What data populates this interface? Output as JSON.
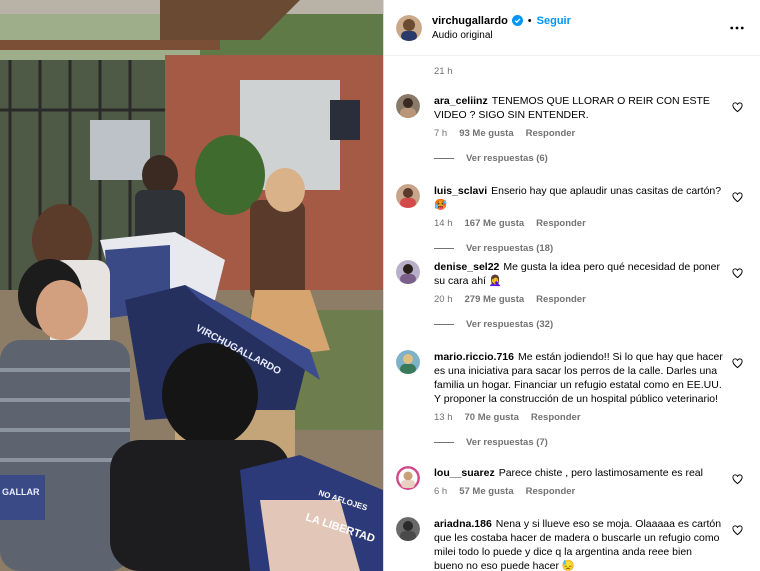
{
  "header": {
    "username": "virchugallardo",
    "follow_label": "Seguir",
    "separator": "•",
    "audio": "Audio original",
    "more_icon": "more-options-icon"
  },
  "top_time": "21 h",
  "comments": [
    {
      "user": "ara_celiinz",
      "text": "TENEMOS QUE LLORAR O REIR CON ESTE VIDEO ? SIGO SIN ENTENDER.",
      "time": "7 h",
      "likes": "93 Me gusta",
      "reply": "Responder",
      "replies": "Ver respuestas (6)"
    },
    {
      "user": "luis_sclavi",
      "text": "Enserio hay que aplaudir unas casitas de cartón? 🥵",
      "time": "14 h",
      "likes": "167 Me gusta",
      "reply": "Responder",
      "replies": "Ver respuestas (18)"
    },
    {
      "user": "denise_sel22",
      "text": "Me gusta la idea pero qué necesidad de poner su cara ahí 🤦‍♀️",
      "time": "20 h",
      "likes": "279 Me gusta",
      "reply": "Responder",
      "replies": "Ver respuestas (32)"
    },
    {
      "user": "mario.riccio.716",
      "text": "Me están jodiendo!! Si lo que hay que hacer es una iniciativa para sacar los perros de la calle. Darles una familia un hogar. Financiar un refugio estatal como en EE.UU. Y proponer la construcción de un hospital público veterinario!",
      "time": "13 h",
      "likes": "70 Me gusta",
      "reply": "Responder",
      "replies": "Ver respuestas (7)"
    },
    {
      "user": "lou__suarez",
      "text": "Parece chiste , pero lastimosamente es real",
      "time": "6 h",
      "likes": "57 Me gusta",
      "reply": "Responder",
      "replies": ""
    },
    {
      "user": "ariadna.186",
      "text": "Nena y si llueve eso se moja. Olaaaaa es cartón que les costaba hacer de madera o buscarle un refugio como milei todo lo puede y dice q la argentina anda reee bien bueno no eso puede hacer 😓",
      "time": "",
      "likes": "",
      "reply": "",
      "replies": ""
    }
  ],
  "media": {
    "box_text_1": "VIRCHUGALLARDO",
    "box_text_2": "LA LIBERTAD",
    "box_text_3": "NO AFLOJES",
    "box_text_4": "GALLAR"
  },
  "colors": {
    "accent": "#0095f6",
    "secondary_text": "#737373",
    "verified_blue": "#0095f6"
  }
}
